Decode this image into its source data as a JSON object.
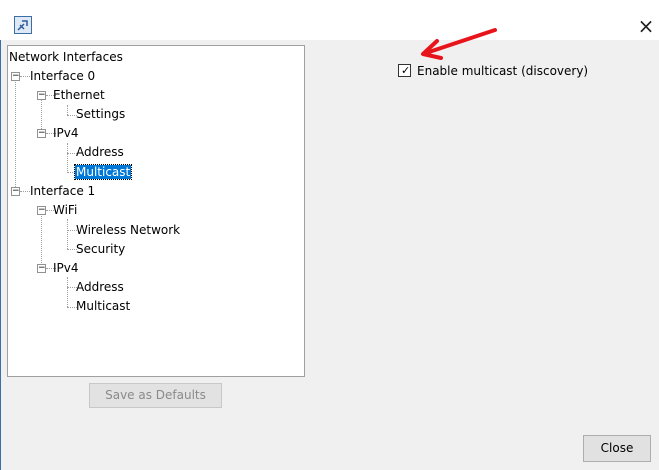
{
  "window": {
    "close_glyph": "×",
    "icon": "app-icon"
  },
  "tree": {
    "root": "Network Interfaces",
    "interface0": {
      "label": "Interface 0",
      "ethernet": {
        "label": "Ethernet",
        "settings": "Settings"
      },
      "ipv4": {
        "label": "IPv4",
        "address": "Address",
        "multicast": "Multicast"
      }
    },
    "interface1": {
      "label": "Interface 1",
      "wifi": {
        "label": "WiFi",
        "wireless": "Wireless Network",
        "security": "Security"
      },
      "ipv4": {
        "label": "IPv4",
        "address": "Address",
        "multicast": "Multicast"
      }
    },
    "selected": "Multicast"
  },
  "settings": {
    "enable_multicast": {
      "label": "Enable multicast (discovery)",
      "checked": true
    }
  },
  "buttons": {
    "save_defaults": "Save as Defaults",
    "close": "Close"
  },
  "annotation": {
    "arrow_color": "#e8141b"
  }
}
